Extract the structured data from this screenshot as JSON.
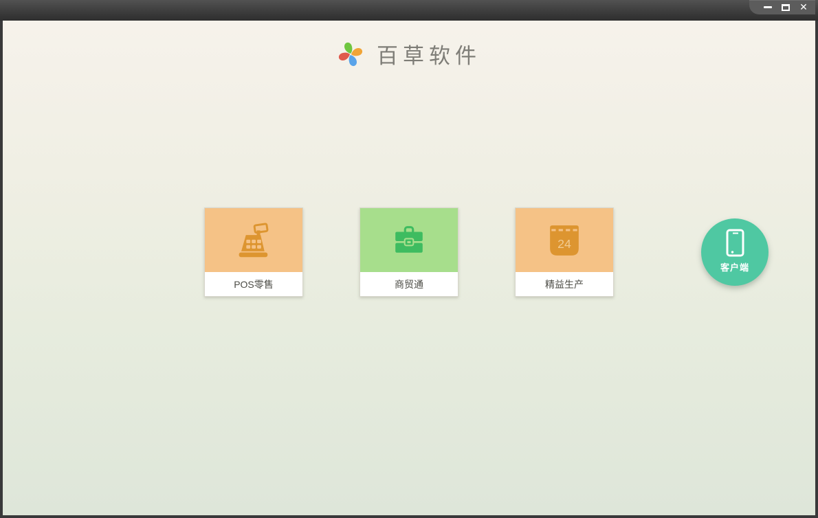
{
  "window": {
    "controls": [
      {
        "name": "minimize",
        "icon": "minimize-icon"
      },
      {
        "name": "maximize",
        "icon": "maximize-icon"
      },
      {
        "name": "close",
        "icon": "close-icon"
      }
    ],
    "titlebar_color": "#3d3d3d"
  },
  "header": {
    "app_title": "百草软件",
    "logo_icon": "pinwheel-logo-icon",
    "logo_colors": {
      "top": "#6fc640",
      "right": "#f0a437",
      "bottom": "#59a3e9",
      "left": "#e05a4d"
    }
  },
  "products": [
    {
      "label": "POS零售",
      "icon": "cash-register-icon",
      "card_color": "#f5c286",
      "icon_color": "#dd9530"
    },
    {
      "label": "商贸通",
      "icon": "briefcase-icon",
      "card_color": "#a7de8c",
      "icon_color": "#3ebc60"
    },
    {
      "label": "精益生产",
      "icon": "calendar-icon",
      "calendar_day": "24",
      "card_color": "#f5c286",
      "icon_color": "#dd9530"
    }
  ],
  "client_button": {
    "label": "客户端",
    "icon": "smartphone-icon",
    "color": "#4fc8a2"
  },
  "background": {
    "top": "#f6f2eb",
    "bottom": "#dee6d9"
  }
}
